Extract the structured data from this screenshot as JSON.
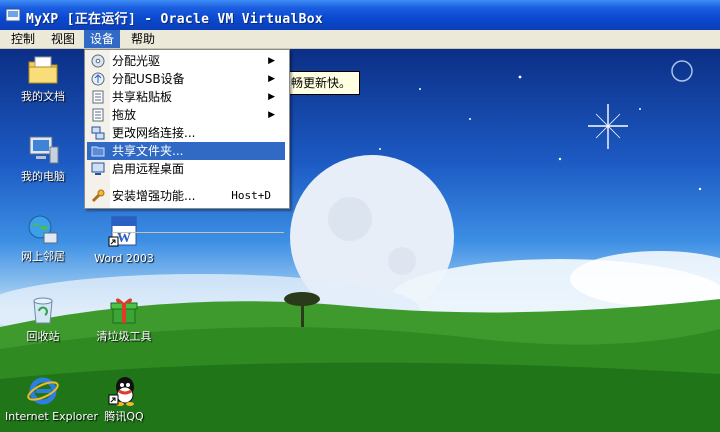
{
  "window": {
    "title": "MyXP [正在运行] - Oracle VM VirtualBox"
  },
  "menubar": {
    "items": [
      "控制",
      "视图",
      "设备",
      "帮助"
    ]
  },
  "devices_menu": {
    "items": [
      {
        "label": "分配光驱",
        "icon": "cd-icon",
        "submenu": true
      },
      {
        "label": "分配USB设备",
        "icon": "usb-icon",
        "submenu": true
      },
      {
        "label": "共享粘贴板",
        "icon": "clipboard-icon",
        "submenu": true
      },
      {
        "label": "拖放",
        "icon": "drag-drop-icon",
        "submenu": true
      },
      {
        "label": "更改网络连接...",
        "icon": "network-icon",
        "submenu": false
      },
      {
        "label": "共享文件夹...",
        "icon": "shared-folder-icon",
        "submenu": false,
        "highlighted": true
      },
      {
        "label": "启用远程桌面",
        "icon": "remote-desktop-icon",
        "submenu": false
      },
      {
        "label": "安装增强功能...",
        "icon": "guest-additions-icon",
        "submenu": false,
        "shortcut": "Host+D"
      }
    ]
  },
  "tooltip": {
    "text": "畅更新快。"
  },
  "desktop": {
    "icons": [
      {
        "label": "我的文档",
        "icon": "my-documents-icon"
      },
      {
        "label": "我的电脑",
        "icon": "my-computer-icon"
      },
      {
        "label": "网上邻居",
        "icon": "network-places-icon"
      },
      {
        "label": "Word 2003",
        "icon": "word-icon"
      },
      {
        "label": "回收站",
        "icon": "recycle-bin-icon"
      },
      {
        "label": "清垃圾工具",
        "icon": "cleaner-gift-icon"
      },
      {
        "label": "Internet Explorer",
        "icon": "ie-icon"
      },
      {
        "label": "腾讯QQ",
        "icon": "qq-icon"
      }
    ]
  },
  "colors": {
    "title_bar": "#0a49d0",
    "menu_highlight": "#316ac5",
    "menu_bar": "#ece9d8"
  }
}
